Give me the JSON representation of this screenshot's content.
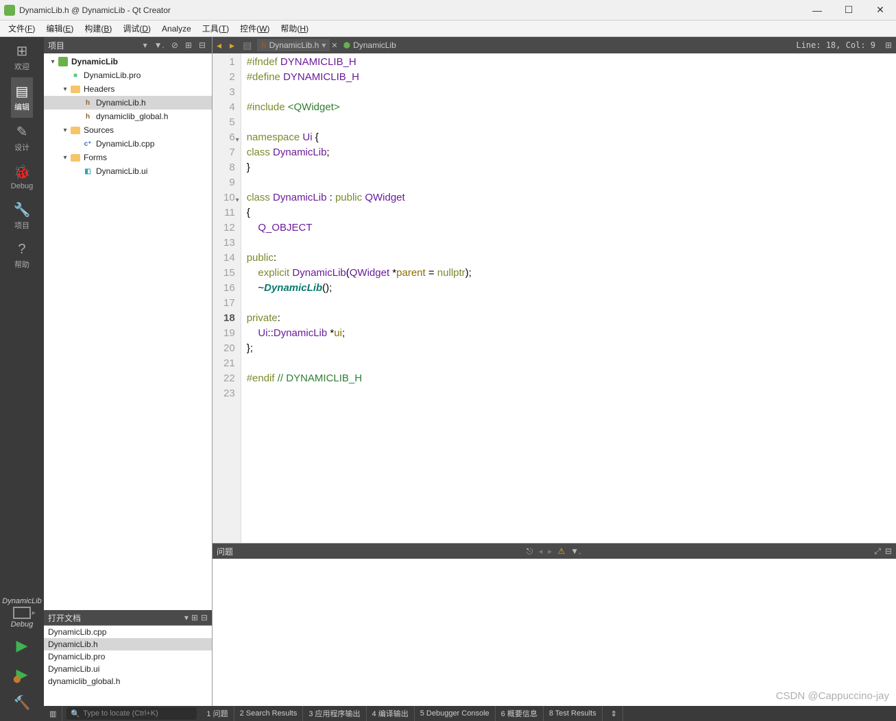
{
  "window": {
    "title": "DynamicLib.h @ DynamicLib - Qt Creator"
  },
  "menu": [
    "文件(F)",
    "编辑(E)",
    "构建(B)",
    "调试(D)",
    "Analyze",
    "工具(T)",
    "控件(W)",
    "帮助(H)"
  ],
  "leftbar": {
    "items": [
      {
        "label": "欢迎",
        "icon": "⊞"
      },
      {
        "label": "编辑",
        "icon": "▤",
        "active": true
      },
      {
        "label": "设计",
        "icon": "✎"
      },
      {
        "label": "Debug",
        "icon": "🐞"
      },
      {
        "label": "项目",
        "icon": "🔧"
      },
      {
        "label": "帮助",
        "icon": "?"
      }
    ],
    "kit": "DynamicLib",
    "kitmode": "Debug"
  },
  "sidebar": {
    "header": "项目",
    "tree": [
      {
        "depth": 0,
        "arrow": "▾",
        "icon": "project",
        "label": "DynamicLib",
        "bold": true
      },
      {
        "depth": 1,
        "arrow": "",
        "icon": "pro",
        "label": "DynamicLib.pro"
      },
      {
        "depth": 1,
        "arrow": "▾",
        "icon": "folder",
        "label": "Headers"
      },
      {
        "depth": 2,
        "arrow": "",
        "icon": "h",
        "label": "DynamicLib.h",
        "sel": true
      },
      {
        "depth": 2,
        "arrow": "",
        "icon": "h",
        "label": "dynamiclib_global.h"
      },
      {
        "depth": 1,
        "arrow": "▾",
        "icon": "folder",
        "label": "Sources"
      },
      {
        "depth": 2,
        "arrow": "",
        "icon": "cpp",
        "label": "DynamicLib.cpp"
      },
      {
        "depth": 1,
        "arrow": "▾",
        "icon": "folder",
        "label": "Forms"
      },
      {
        "depth": 2,
        "arrow": "",
        "icon": "ui",
        "label": "DynamicLib.ui"
      }
    ],
    "open_header": "打开文档",
    "open_docs": [
      {
        "label": "DynamicLib.cpp"
      },
      {
        "label": "DynamicLib.h",
        "sel": true
      },
      {
        "label": "DynamicLib.pro"
      },
      {
        "label": "DynamicLib.ui"
      },
      {
        "label": "dynamiclib_global.h"
      }
    ]
  },
  "editor": {
    "tab_file": "DynamicLib.h",
    "tab_target": "DynamicLib",
    "linecol": "Line: 18, Col: 9",
    "lines": [
      {
        "n": 1,
        "html": "<span class='tok-pp'>#ifndef</span> <span class='tok-ty'>DYNAMICLIB_H</span>"
      },
      {
        "n": 2,
        "html": "<span class='tok-pp'>#define</span> <span class='tok-ty'>DYNAMICLIB_H</span>"
      },
      {
        "n": 3,
        "html": ""
      },
      {
        "n": 4,
        "html": "<span class='tok-pp'>#include</span> <span class='tok-str'>&lt;QWidget&gt;</span>"
      },
      {
        "n": 5,
        "html": ""
      },
      {
        "n": 6,
        "fold": "▾",
        "html": "<span class='tok-kw'>namespace</span> <span class='tok-ty'>Ui</span> {"
      },
      {
        "n": 7,
        "html": "<span class='tok-kw'>class</span> <span class='tok-ty'>DynamicLib</span>;"
      },
      {
        "n": 8,
        "html": "}"
      },
      {
        "n": 9,
        "html": ""
      },
      {
        "n": 10,
        "fold": "▾",
        "html": "<span class='tok-kw'>class</span> <span class='tok-ty'>DynamicLib</span> : <span class='tok-kw'>public</span> <span class='tok-ty'>QWidget</span>"
      },
      {
        "n": 11,
        "html": "{"
      },
      {
        "n": 12,
        "html": "    <span class='tok-ty'>Q_OBJECT</span>"
      },
      {
        "n": 13,
        "html": ""
      },
      {
        "n": 14,
        "html": "<span class='tok-kw'>public</span>:"
      },
      {
        "n": 15,
        "html": "    <span class='tok-kw'>explicit</span> <span class='tok-ty'>DynamicLib</span>(<span class='tok-ty'>QWidget</span> *<span class='tok-id'>parent</span> = <span class='tok-kw'>nullptr</span>);"
      },
      {
        "n": 16,
        "html": "    ~<span class='tok-it'>DynamicLib</span>();"
      },
      {
        "n": 17,
        "html": ""
      },
      {
        "n": 18,
        "cur": true,
        "html": "<span class='tok-kw'>private</span>:"
      },
      {
        "n": 19,
        "html": "    <span class='tok-ty'>Ui</span>::<span class='tok-ty'>DynamicLib</span> *<span class='tok-id'>ui</span>;"
      },
      {
        "n": 20,
        "html": "};"
      },
      {
        "n": 21,
        "html": ""
      },
      {
        "n": 22,
        "html": "<span class='tok-pp'>#endif</span> <span class='tok-cm'>// DYNAMICLIB_H</span>"
      },
      {
        "n": 23,
        "html": ""
      }
    ]
  },
  "problems": {
    "title": "问题"
  },
  "status": {
    "locator_placeholder": "Type to locate (Ctrl+K)",
    "tabs": [
      "1 问题",
      "2 Search Results",
      "3 应用程序输出",
      "4 编译输出",
      "5 Debugger Console",
      "6 概要信息",
      "8 Test Results"
    ]
  },
  "watermark": "CSDN @Cappuccino-jay"
}
